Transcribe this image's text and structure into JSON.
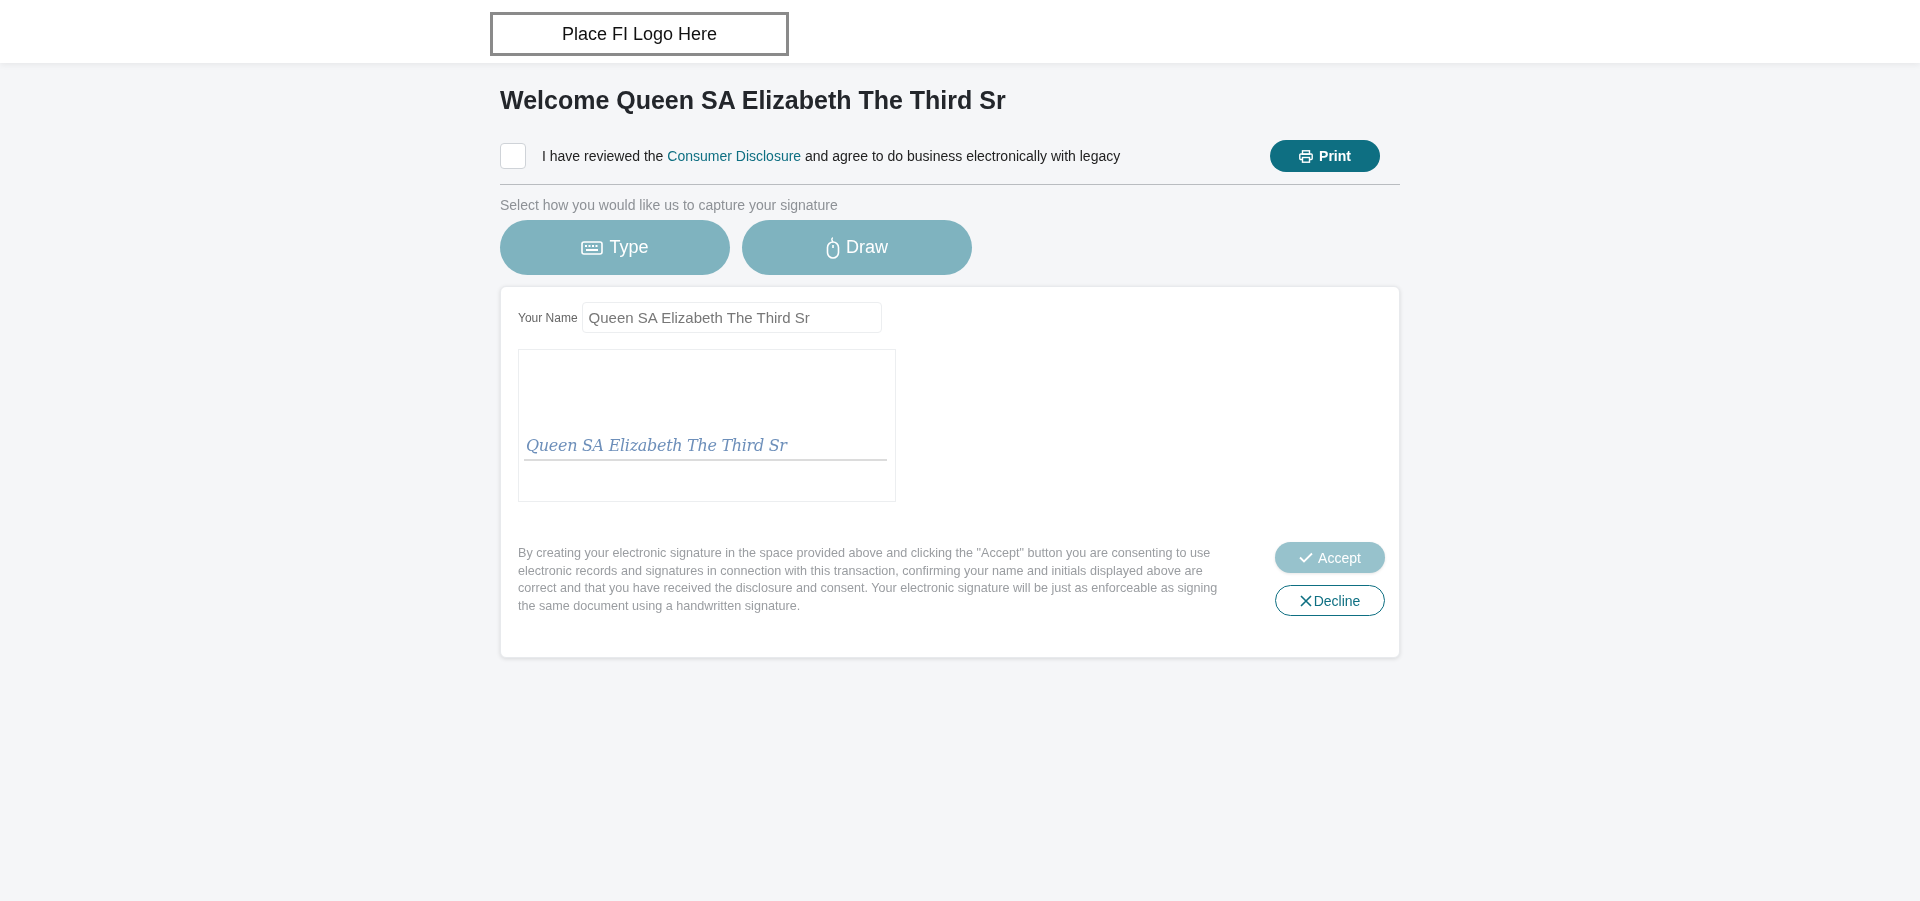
{
  "header": {
    "logo_placeholder": "Place FI Logo Here"
  },
  "welcome": "Welcome Queen SA Elizabeth The Third Sr",
  "consent": {
    "checked": false,
    "text_before": "I have reviewed the ",
    "link": "Consumer Disclosure",
    "text_after": " and agree to do business electronically with legacy"
  },
  "print_button": "Print",
  "method_prompt": "Select how you would like us to capture your signature",
  "methods": [
    {
      "kind": "type",
      "label": "Type",
      "selected": false
    },
    {
      "kind": "draw",
      "label": "Draw",
      "selected": false
    }
  ],
  "name_field": {
    "label": "Your Name",
    "value": "Queen SA Elizabeth The Third Sr"
  },
  "signature": "Queen SA Elizabeth The Third Sr",
  "disclaimer": "By creating your electronic signature in the space provided above and clicking the \"Accept\" button you are consenting to use electronic records and signatures in connection with this transaction, confirming your name and initials displayed above are correct and that you have received the disclosure and consent. Your electronic signature will be just as enforceable as signing the same document using a handwritten signature.",
  "accept_button": {
    "label": "Accept",
    "disabled": true
  },
  "decline_button": {
    "label": "Decline"
  }
}
